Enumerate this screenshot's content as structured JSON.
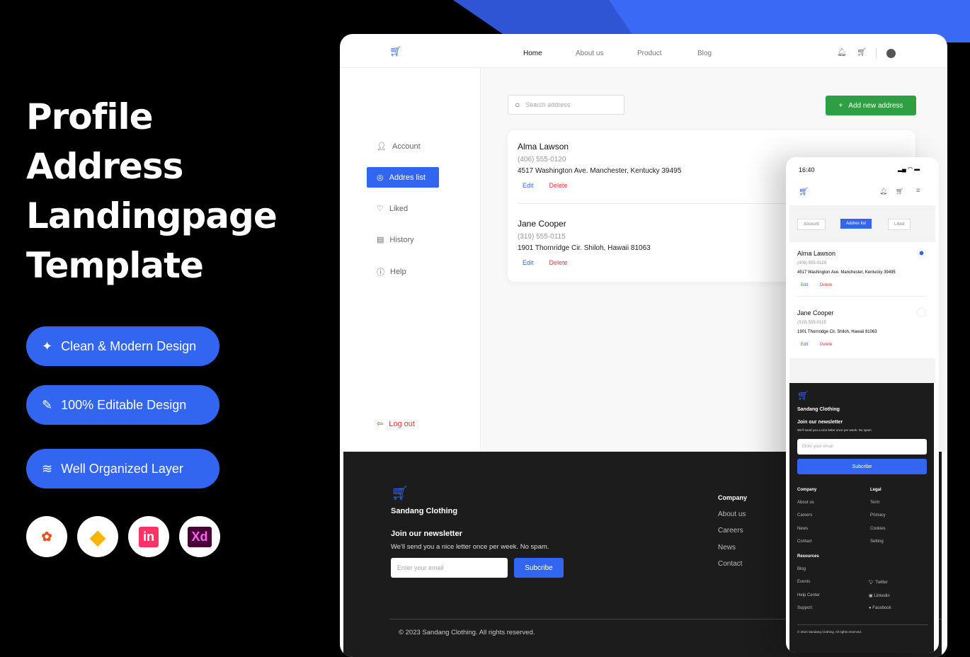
{
  "promo": {
    "title_lines": [
      "Profile",
      "Address",
      "Landingpage",
      "Template"
    ],
    "features": [
      "Clean & Modern Design",
      "100% Editable Design",
      "Well Organized Layer"
    ],
    "tools": [
      {
        "name": "figma",
        "color": "#f24e1e"
      },
      {
        "name": "sketch",
        "color": "#f7b500"
      },
      {
        "name": "invision",
        "label": "in",
        "color": "#ff3366"
      },
      {
        "name": "xd",
        "label": "Xd",
        "color": "#ff61f6"
      }
    ]
  },
  "colors": {
    "accent": "#3366f0",
    "green": "#2ea043",
    "danger": "#e53935",
    "dark": "#1c1c1c"
  },
  "nav": {
    "items": [
      "Home",
      "About us",
      "Product",
      "Blog"
    ]
  },
  "sidebar": {
    "items": [
      "Account",
      "Addres list",
      "Liked",
      "History",
      "Help"
    ],
    "logout": "Log out"
  },
  "search": {
    "placeholder": "Search address"
  },
  "add_button": "Add new address",
  "addresses": [
    {
      "name": "Alma Lawson",
      "phone": "(406) 555-0120",
      "address": "4517 Washington Ave. Manchester, Kentucky 39495",
      "edit": "Edit",
      "delete": "Delete",
      "selected": true
    },
    {
      "name": "Jane Cooper",
      "phone": "(319) 555-0115",
      "address": "1901 Thornridge Cir. Shiloh, Hawaii 81063",
      "edit": "Edit",
      "delete": "Delete",
      "selected": false
    }
  ],
  "footer": {
    "brand": "Sandang Clothing",
    "newsletter_title": "Join our newsletter",
    "newsletter_text": "We'll send you a nice letter once per week. No spam.",
    "email_placeholder": "Enter your email",
    "subscribe": "Subcribe",
    "company_title": "Company",
    "company": [
      "About us",
      "Careers",
      "News",
      "Contact"
    ],
    "legal_title": "Legal",
    "legal": [
      "Term",
      "Primacy",
      "Cookies",
      "Setting"
    ],
    "resources_title": "Resources",
    "resources": [
      "Blog",
      "Events",
      "Help Center",
      "Support"
    ],
    "social": [
      "Twitter",
      "Linkedin",
      "Facebook"
    ],
    "copyright": "© 2023 Sandang Clothing. All rights reserved."
  },
  "mobile": {
    "time": "16:40",
    "tabs": [
      "Account",
      "Addres list",
      "Liked"
    ]
  }
}
